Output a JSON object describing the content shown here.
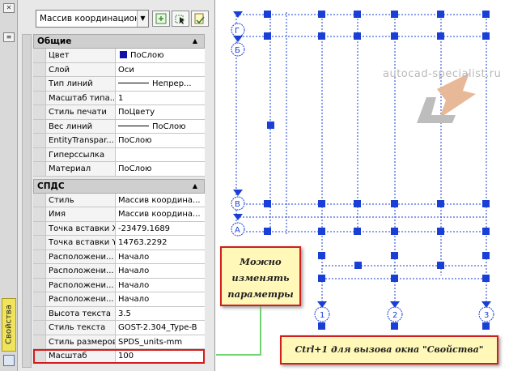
{
  "palette": {
    "vertical_tab": "Свойства",
    "object_selector": "Массив координационн",
    "sections": [
      {
        "title": "Общие",
        "rows": [
          {
            "name": "Цвет",
            "value": "ПоСлою",
            "kind": "color"
          },
          {
            "name": "Слой",
            "value": "Оси"
          },
          {
            "name": "Тип линий",
            "value": "Непрер...",
            "kind": "linetype"
          },
          {
            "name": "Масштаб типа...",
            "value": "1"
          },
          {
            "name": "Стиль печати",
            "value": "ПоЦвету"
          },
          {
            "name": "Вес линий",
            "value": "ПоСлою",
            "kind": "linetype"
          },
          {
            "name": "EntityTranspar...",
            "value": "ПоСлою"
          },
          {
            "name": "Гиперссылка",
            "value": ""
          },
          {
            "name": "Материал",
            "value": "ПоСлою"
          }
        ]
      },
      {
        "title": "СПДС",
        "rows": [
          {
            "name": "Стиль",
            "value": "Массив координа..."
          },
          {
            "name": "Имя",
            "value": "Массив координа..."
          },
          {
            "name": "Точка вставки X",
            "value": "-23479.1689"
          },
          {
            "name": "Точка вставки Y",
            "value": "14763.2292"
          },
          {
            "name": "Расположени...",
            "value": "Начало"
          },
          {
            "name": "Расположени...",
            "value": "Начало"
          },
          {
            "name": "Расположени...",
            "value": "Начало"
          },
          {
            "name": "Расположени...",
            "value": "Начало"
          },
          {
            "name": "Высота текста",
            "value": "3.5"
          },
          {
            "name": "Стиль текста",
            "value": "GOST-2.304_Type-B"
          },
          {
            "name": "Стиль размеров",
            "value": "SPDS_units-mm"
          },
          {
            "name": "Масштаб",
            "value": "100",
            "highlight": true
          }
        ]
      }
    ]
  },
  "drawing": {
    "watermark": "autocad-specialist.ru",
    "axis_letters": [
      "Г",
      "В",
      "Б",
      "А"
    ],
    "axis_numbers": [
      "1",
      "2",
      "3"
    ],
    "accent_color": "#d01f1f",
    "grip_color": "#1a3fd6"
  },
  "callouts": {
    "params": [
      "Можно",
      "изменять",
      "параметры"
    ],
    "hint": "Ctrl+1 для вызова окна \"Свойства\""
  }
}
